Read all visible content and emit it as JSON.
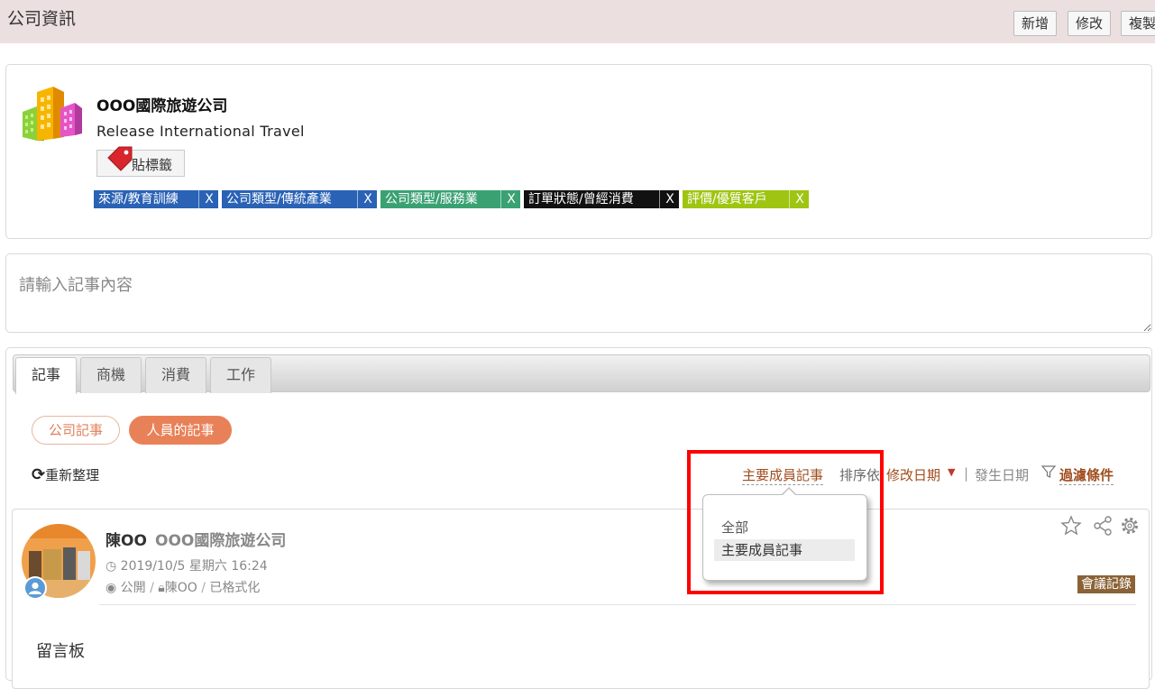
{
  "header": {
    "title": "公司資訊",
    "buttons": [
      "新增",
      "修改",
      "複製"
    ]
  },
  "company": {
    "name": "OOO國際旅遊公司",
    "english_name": "Release International Travel",
    "tag_button_label": "貼標籤",
    "tags": [
      {
        "label": "來源/教育訓練",
        "remove": "X",
        "color": "#2a62b5"
      },
      {
        "label": "公司類型/傳統產業",
        "remove": "X",
        "color": "#2a62b5"
      },
      {
        "label": "公司類型/服務業",
        "remove": "X",
        "color": "#3aa173"
      },
      {
        "label": "訂單狀態/曾經消費",
        "remove": "X",
        "color": "#111111"
      },
      {
        "label": "評價/優質客戶",
        "remove": "X",
        "color": "#9fc512"
      }
    ]
  },
  "note_input": {
    "placeholder": "請輸入記事內容"
  },
  "tabs": [
    {
      "label": "記事",
      "active": true
    },
    {
      "label": "商機",
      "active": false
    },
    {
      "label": "消費",
      "active": false
    },
    {
      "label": "工作",
      "active": false
    }
  ],
  "note_filters": {
    "company_notes": "公司記事",
    "people_notes": "人員的記事"
  },
  "toolbar": {
    "refresh_label": "重新整理",
    "member_filter": "主要成員記事",
    "sort_by_label": "排序依",
    "sort_modified": "修改日期",
    "separator": "|",
    "sort_occurred": "發生日期",
    "filter_label": "過濾條件"
  },
  "dropdown": {
    "options": [
      "全部",
      "主要成員記事"
    ],
    "selected": "主要成員記事"
  },
  "post": {
    "author": "陳OO",
    "company": "OOO國際旅遊公司",
    "datetime": "2019/10/5 星期六 16:24",
    "visibility": "公開",
    "lock_owner": "陳OO",
    "format": "已格式化",
    "category_badge": "會議記錄",
    "board_label": "留言板"
  },
  "accent_colors": {
    "highlight_border": "#ff0000",
    "active_pill": "#e98158",
    "link": "#a04d1e"
  }
}
